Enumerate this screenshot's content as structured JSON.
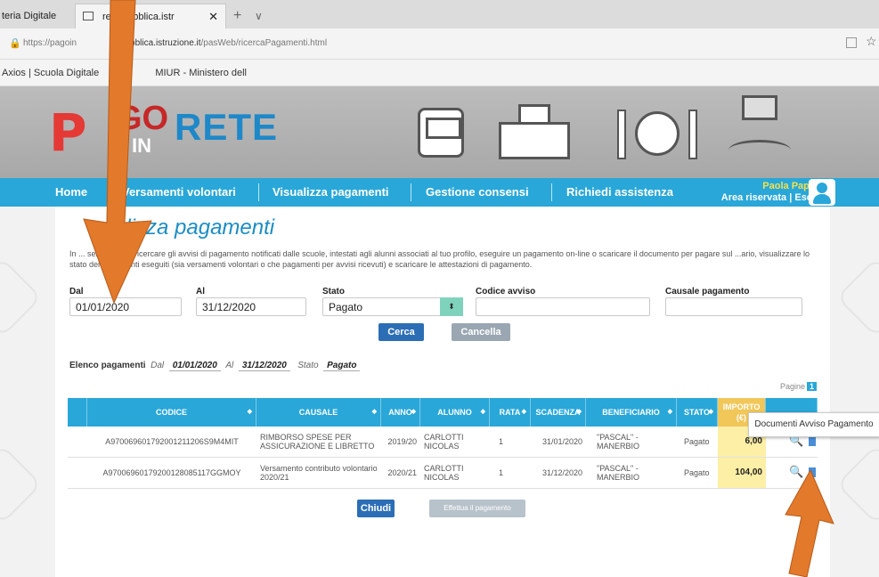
{
  "browser": {
    "tab1_label": "teria Digitale",
    "tab2_label": "rete.pubblica.istr",
    "tab2_close": "✕",
    "tab_new": "+",
    "tab_more": "∨",
    "url_prefix": "https://pagoin",
    "url_domain": "bblica.istruzione.it",
    "url_path": "/pasWeb/ricercaPagamenti.html",
    "favorites": [
      "Axios | Scuola Digitale",
      "MIUR - Ministero dell"
    ]
  },
  "logo": {
    "p": "P",
    "go": "GO",
    "in": "IN",
    "rete": "RETE"
  },
  "nav": {
    "items": [
      "Home",
      "Versamenti volontari",
      "Visualizza pagamenti",
      "Gestione consensi",
      "Richiedi assistenza"
    ],
    "user_name": "Paola Papa",
    "user_area": "Area riservata | Esci"
  },
  "page": {
    "title": "alizza pagamenti",
    "description": "In ... sezione puoi ricercare gli avvisi di pagamento notificati dalle scuole, intestati agli alunni associati al tuo profilo, eseguire un pagamento on-line o scaricare il documento per pagare sul ...ario, visualizzare lo stato dei pagamenti eseguiti (sia versamenti volontari o che pagamenti per avvisi ricevuti) e scaricare le attestazioni di pagamento."
  },
  "filters": {
    "dal_label": "Dal",
    "dal_value": "01/01/2020",
    "al_label": "Al",
    "al_value": "31/12/2020",
    "stato_label": "Stato",
    "stato_value": "Pagato",
    "stato_arrow": "⬍",
    "codice_label": "Codice avviso",
    "codice_value": "",
    "causale_label": "Causale pagamento",
    "causale_value": "",
    "cerca": "Cerca",
    "cancella": "Cancella"
  },
  "elenco": {
    "label": "Elenco pagamenti",
    "dal": "Dal",
    "dal_value": "01/01/2020",
    "al": "Al",
    "al_value": "31/12/2020",
    "stato": "Stato",
    "stato_value": "Pagato",
    "pagine": "Pagine",
    "pagina": "1"
  },
  "table": {
    "headers": [
      "CODICE",
      "CAUSALE",
      "ANNO",
      "ALUNNO",
      "RATA",
      "SCADENZA",
      "BENEFICIARIO",
      "STATO",
      "IMPORTO (€)"
    ],
    "sort_icon": "◆",
    "rows": [
      {
        "codice": "A970069601792001211206S9M4MIT",
        "causale": "RIMBORSO SPESE PER ASSICURAZIONE E LIBRETTO",
        "anno": "2019/20",
        "alunno": "CARLOTTI NICOLAS",
        "rata": "1",
        "scadenza": "31/01/2020",
        "beneficiario": "\"PASCAL\" - MANERBIO",
        "stato": "Pagato",
        "importo": "6,00"
      },
      {
        "codice": "A97006960179200128085117GGMOY",
        "causale": "Versamento contributo volontario 2020/21",
        "anno": "2020/21",
        "alunno": "CARLOTTI NICOLAS",
        "rata": "1",
        "scadenza": "31/12/2020",
        "beneficiario": "\"PASCAL\" - MANERBIO",
        "stato": "Pagato",
        "importo": "104,00"
      }
    ],
    "tooltip": "Documenti Avviso Pagamento"
  },
  "actions": {
    "chiudi": "Chiudi",
    "effettua": "Effettua il pagamento"
  },
  "icons": {
    "lock": "🔒",
    "star": "☆",
    "magnifier": "🔍"
  }
}
